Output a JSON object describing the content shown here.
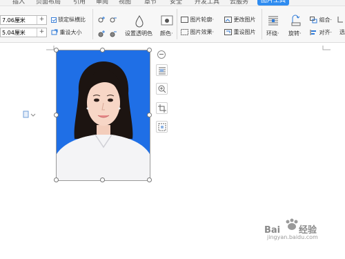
{
  "menu": {
    "tabs": [
      "插入",
      "页面布局",
      "引用",
      "审阅",
      "视图",
      "章节",
      "安全",
      "开发工具",
      "云服务",
      "图片工具"
    ],
    "active_index": 9,
    "accent_color": "#2f8cf0"
  },
  "size": {
    "height_value": "7.06厘米",
    "width_value": "5.04厘米",
    "increment_symbol": "+",
    "lock_ratio_label": "锁定纵横比",
    "lock_ratio_checked": true,
    "reset_size_label": "重设大小"
  },
  "ribbon": {
    "transparent_label": "设置透明色",
    "color_label": "颜色·",
    "outline_label": "图片轮廓·",
    "effect_label": "图片效果·",
    "change_label": "更改图片",
    "reset_label": "重设图片",
    "wrap_label": "环绕·",
    "rotate_label": "旋转·",
    "group_label": "组合·",
    "align_label": "对齐·",
    "cut_label": "选"
  },
  "photo": {
    "background_color": "#1f6fe6"
  },
  "side_tools": [
    "minus-icon",
    "layout-options-icon",
    "zoom-in-icon",
    "crop-icon",
    "select-area-icon"
  ],
  "watermark": {
    "brand": "Bai",
    "brand2": "经验",
    "url": "jingyan.baidu.com"
  }
}
